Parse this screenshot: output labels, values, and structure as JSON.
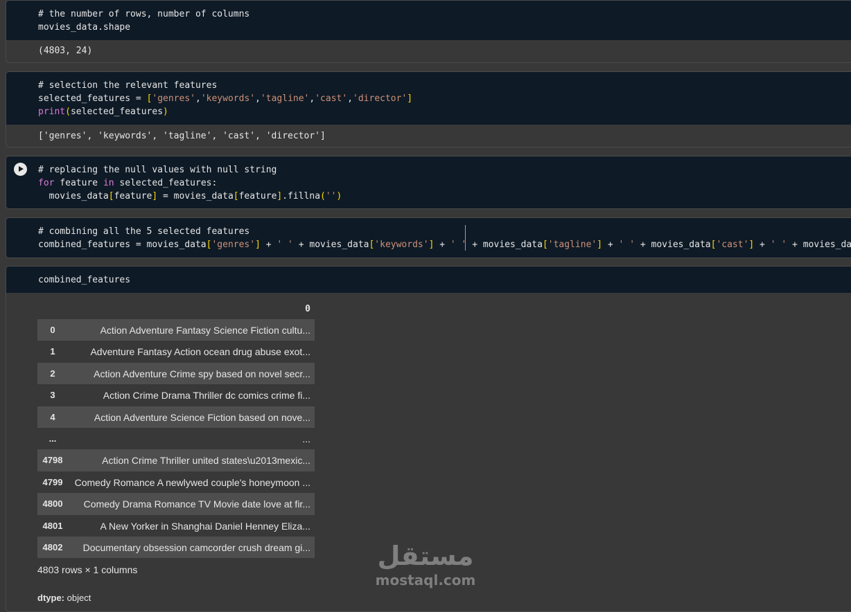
{
  "cells": [
    {
      "comment": "# the number of rows, number of columns",
      "code": "movies_data.shape",
      "output": "(4803, 24)"
    },
    {
      "comment": "# selection the relevant features",
      "line1_var": "selected_features = ",
      "line1_list": [
        "'genres'",
        "'keywords'",
        "'tagline'",
        "'cast'",
        "'director'"
      ],
      "line2_fn": "print",
      "line2_arg": "selected_features",
      "output": "['genres', 'keywords', 'tagline', 'cast', 'director']"
    },
    {
      "comment": "# replacing the null values with null string",
      "kw_for": "for",
      "loop_var": " feature ",
      "kw_in": "in",
      "loop_iter": " selected_features:",
      "body_a": "  movies_data",
      "body_b": "feature",
      "body_c": " = movies_data",
      "body_d": "feature",
      "body_e": ".fillna",
      "body_f": "''"
    },
    {
      "comment": "# combining all the 5 selected features",
      "code_start": "combined_features = movies_data",
      "parts": [
        "'genres'",
        "'keywords'",
        "'tagline'",
        "'cast'"
      ],
      "quote_space": "' '",
      "md": "movies_data",
      "tail": "movies_data"
    },
    {
      "code": "combined_features"
    }
  ],
  "dataframe": {
    "column_header": "0",
    "rows": [
      {
        "index": "0",
        "value": "Action Adventure Fantasy Science Fiction cultu..."
      },
      {
        "index": "1",
        "value": "Adventure Fantasy Action ocean drug abuse exot..."
      },
      {
        "index": "2",
        "value": "Action Adventure Crime spy based on novel secr..."
      },
      {
        "index": "3",
        "value": "Action Crime Drama Thriller dc comics crime fi..."
      },
      {
        "index": "4",
        "value": "Action Adventure Science Fiction based on nove..."
      },
      {
        "index": "...",
        "value": "..."
      },
      {
        "index": "4798",
        "value": "Action Crime Thriller united states\\u2013mexic..."
      },
      {
        "index": "4799",
        "value": "Comedy Romance A newlywed couple's honeymoon ..."
      },
      {
        "index": "4800",
        "value": "Comedy Drama Romance TV Movie date love at fir..."
      },
      {
        "index": "4801",
        "value": "A New Yorker in Shanghai Daniel Henney Eliza..."
      },
      {
        "index": "4802",
        "value": "Documentary obsession camcorder crush dream gi..."
      }
    ],
    "footer": "4803 rows × 1 columns",
    "dtype_label": "dtype:",
    "dtype_value": "object"
  },
  "watermark": {
    "arabic": "مستقل",
    "latin": "mostaql.com"
  },
  "icons": {
    "run": "play-circle-icon"
  }
}
